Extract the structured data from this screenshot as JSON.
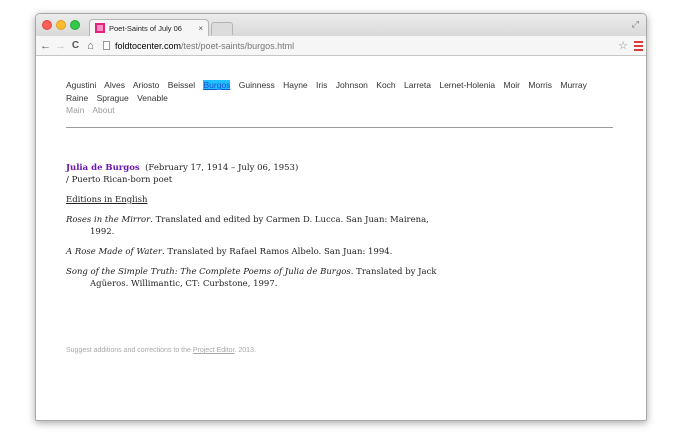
{
  "browser": {
    "tab_title": "Poet-Saints of July 06",
    "tab_close": "×",
    "url_domain": "foldtocenter.com",
    "url_path": "/test/poet-saints/burgos.html",
    "icons": {
      "back": "←",
      "forward": "→",
      "reload": "C",
      "home": "⌂",
      "star": "☆",
      "fullscreen": "⤢"
    }
  },
  "nav": {
    "poets": [
      "Agustini",
      "Alves",
      "Ariosto",
      "Beissel",
      "Burgos",
      "Guinness",
      "Hayne",
      "Iris",
      "Johnson",
      "Koch",
      "Larreta",
      "Lernet-Holenia",
      "Moir",
      "Morris",
      "Murray",
      "Raine",
      "Sprague",
      "Venable"
    ],
    "active": "Burgos",
    "main": "Main",
    "about": "About"
  },
  "entry": {
    "name": "Julia de Burgos",
    "dates": "(February 17, 1914 – July 06, 1953)",
    "description": "/  Puerto Rican-born poet",
    "section_title": "Editions in English",
    "works": [
      {
        "title": "Roses in the Mirror",
        "rest": ". Translated and edited by Carmen D. Lucca. San Juan: Mairena, 1992."
      },
      {
        "title": "A Rose Made of Water",
        "rest": ". Translated by Rafael Ramos Albelo. San Juan: 1994."
      },
      {
        "title": "Song of the Simple Truth: The Complete Poems of Julia de Burgos",
        "rest": ". Translated by Jack Agüeros. Willimantic, CT: Curbstone, 1997."
      }
    ]
  },
  "footer": {
    "text_before": "Suggest additions and corrections to the ",
    "link": "Project Editor",
    "text_after": ". 2013."
  },
  "colors": {
    "active_highlight": "#1fc1ff",
    "poet_name": "#6b15b0",
    "menu_icon": "#d93a3a"
  }
}
